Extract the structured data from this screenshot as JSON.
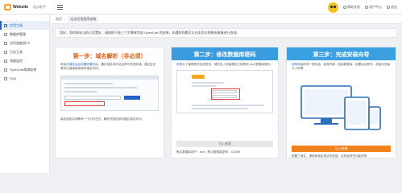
{
  "header": {
    "brand": "Website",
    "subtitle": "站点助手",
    "links": [
      {
        "label": "帮助文档"
      },
      {
        "label": "用户中心"
      },
      {
        "label": "退出"
      }
    ]
  },
  "sidebar": {
    "items": [
      {
        "label": "实用工具",
        "active": true
      },
      {
        "label": "数据库管理",
        "active": false
      },
      {
        "label": "访问速度测TP",
        "active": false
      },
      {
        "label": "日志工具",
        "active": false
      },
      {
        "label": "流量监控",
        "active": false
      },
      {
        "label": "OpenCart商城安装",
        "active": false
      },
      {
        "label": "FAQ",
        "active": false
      }
    ]
  },
  "breadcrumb": {
    "home": "首页",
    "current": "站点应用程序安装"
  },
  "notice": "您好，您的网站当前已设置好，请按照下面三个步骤来完成 OpenCart 的安装，如遇到问题可以在本页右侧联系客服进行咨询。",
  "steps": {
    "step1": {
      "title": "第一步：域名解析（非必须）",
      "desc_prefix": "添加",
      "desc_link": "在域名后台设置好解析",
      "desc_rest": "后，通过域名访问站点即可完成安装；跳过此步骤可以直接使用临时域名访问。",
      "note": "域名绑定后请等待一个小时左右，解析完成后即可通过域名访问。"
    },
    "step2": {
      "title": "第二步：修改数据库密码",
      "desc_link": "说明",
      "desc_rest": "为了保障您的应用安全，请在进入安装程序之前修改 root 数据库密码。",
      "button": "马上修改",
      "footer": "默认数据库用户：root，默认数据库密码：123456"
    },
    "step3": {
      "title": "第三步：完成安装向导",
      "desc_link": "说明",
      "desc_rest": "安装向导一般包括：检查环境→连接数据库→设置后台账号→初始化安装几个步骤",
      "button": "马上安装",
      "footer": "配置了域名，请使用域名来访问安装，否则会有些功能异常"
    }
  },
  "colors": {
    "accent_blue": "#1e64c8",
    "header_blue": "#3a9bdf",
    "step1_orange": "#e05a0c",
    "install_orange": "#f0821e"
  }
}
